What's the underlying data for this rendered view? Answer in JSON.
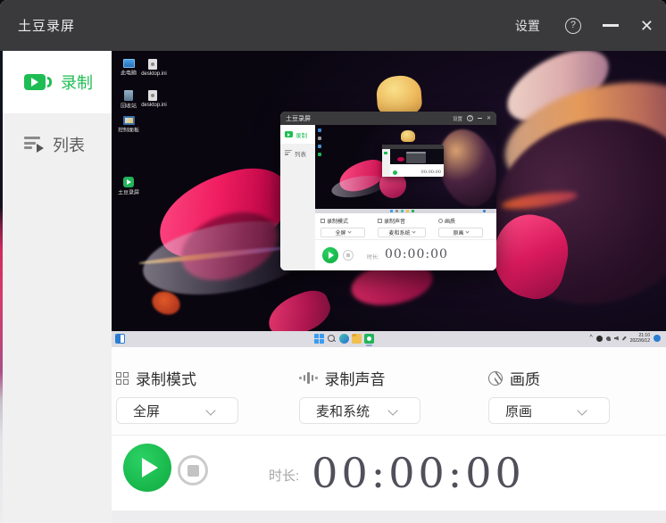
{
  "titlebar": {
    "title": "土豆录屏",
    "settings_label": "设置",
    "help_glyph": "?",
    "close_glyph": "✕"
  },
  "sidebar": {
    "items": [
      {
        "label": "录制",
        "active": true
      },
      {
        "label": "列表",
        "active": false
      }
    ]
  },
  "controls": {
    "mode": {
      "label": "录制模式",
      "value": "全屏"
    },
    "sound": {
      "label": "录制声音",
      "value": "麦和系统"
    },
    "quality": {
      "label": "画质",
      "value": "原画"
    }
  },
  "playback": {
    "duration_label": "时长:",
    "timer": "00:00:00"
  },
  "preview": {
    "desktop_icons": [
      {
        "label": "此电脑"
      },
      {
        "label": "desktop.ini"
      },
      {
        "label": "回收站"
      },
      {
        "label": "desktop.ini"
      },
      {
        "label": "控制面板"
      },
      {
        "label": "土豆录屏"
      }
    ],
    "taskbar": {
      "time": "21:10",
      "date": "2022/6/12"
    },
    "nested_window": {
      "title": "土豆录屏",
      "settings_label": "设置",
      "help_glyph": "?",
      "close_glyph": "✕",
      "record_label": "录制",
      "list_label": "列表",
      "mode_label": "录制模式",
      "mode_value": "全屏",
      "sound_label": "录制声音",
      "sound_value": "麦和系统",
      "quality_label": "画质",
      "quality_value": "原画",
      "duration_label": "时长:",
      "timer": "00:00:00",
      "inner_timer": "00:00:00"
    }
  },
  "colors": {
    "accent_green": "#1ebd53",
    "titlebar_bg": "#3a3a3c",
    "timer_color": "#50505a"
  }
}
